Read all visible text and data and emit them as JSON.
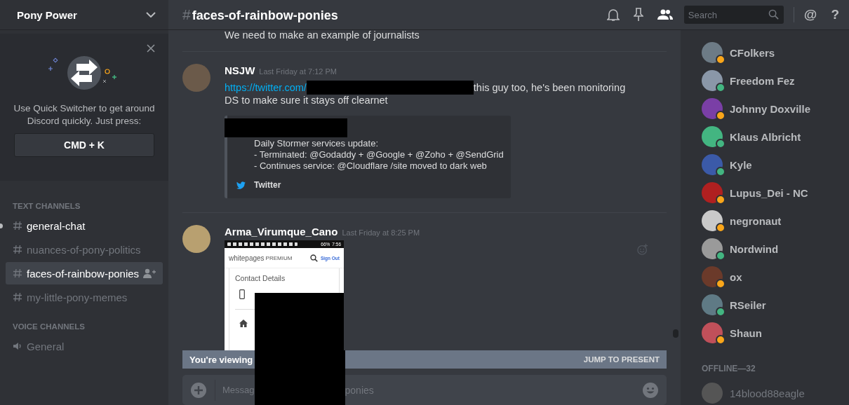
{
  "server": {
    "name": "Pony Power"
  },
  "quick_switcher": {
    "text": "Use Quick Switcher to get around Discord quickly. Just press:",
    "shortcut": "CMD + K"
  },
  "channel_groups": [
    {
      "title": "TEXT CHANNELS",
      "kind": "text",
      "channels": [
        {
          "name": "general-chat",
          "selected": false,
          "unread": true
        },
        {
          "name": "nuances-of-pony-politics",
          "selected": false,
          "unread": false
        },
        {
          "name": "faces-of-rainbow-ponies",
          "selected": true,
          "unread": false
        },
        {
          "name": "my-little-pony-memes",
          "selected": false,
          "unread": false
        }
      ]
    },
    {
      "title": "VOICE CHANNELS",
      "kind": "voice",
      "channels": [
        {
          "name": "General",
          "selected": false,
          "unread": false
        }
      ]
    }
  ],
  "header": {
    "hash": "#",
    "channel": "faces-of-rainbow-ponies",
    "search": {
      "placeholder": "Search"
    },
    "mention": "@",
    "help": "?"
  },
  "messages": [
    {
      "kind": "continuation",
      "text": "We need to make an example of journalists"
    },
    {
      "kind": "text",
      "author": "NSJW",
      "time": "Last Friday at 7:12 PM",
      "link": "https://twitter.com/",
      "text": "this guy too, he's been monitoring DS to make sure it stays off clearnet",
      "embed": {
        "lines": [
          "Daily Stormer services update:",
          "- Terminated: @Godaddy + @Google + @Zoho + @SendGrid",
          "- Continues service: @Cloudflare /site moved to dark web"
        ],
        "provider": "Twitter"
      }
    },
    {
      "kind": "image",
      "author": "Arma_Virumque_Cano",
      "time": "Last Friday at 8:25 PM",
      "phone": {
        "battery": "66%",
        "clock": "7:56",
        "brand": "whitepages",
        "tier": "PREMIUM",
        "sign_out": "Sign Out",
        "section": "Contact Details"
      }
    }
  ],
  "banner": {
    "text": "You're viewing",
    "action": "JUMP TO PRESENT"
  },
  "composer": {
    "placeholder_start": "Messag",
    "placeholder_end": "ponies"
  },
  "members": {
    "online": [
      {
        "name": "CFolkers",
        "color": "#faa61a"
      },
      {
        "name": "Freedom Fez",
        "color": "#43b581"
      },
      {
        "name": "Johnny Doxville",
        "color": "#faa61a"
      },
      {
        "name": "Klaus Albricht",
        "color": "#43b581"
      },
      {
        "name": "Kyle",
        "color": "#43b581"
      },
      {
        "name": "Lupus_Dei - NC",
        "color": "#faa61a"
      },
      {
        "name": "negronaut",
        "color": "#faa61a"
      },
      {
        "name": "Nordwind",
        "color": "#43b581"
      },
      {
        "name": "ox",
        "color": "#faa61a"
      },
      {
        "name": "RSeiler",
        "color": "#43b581"
      },
      {
        "name": "Shaun",
        "color": "#faa61a"
      }
    ],
    "offline_title": "OFFLINE—32",
    "offline": [
      {
        "name": "14blood88eagle"
      }
    ]
  }
}
